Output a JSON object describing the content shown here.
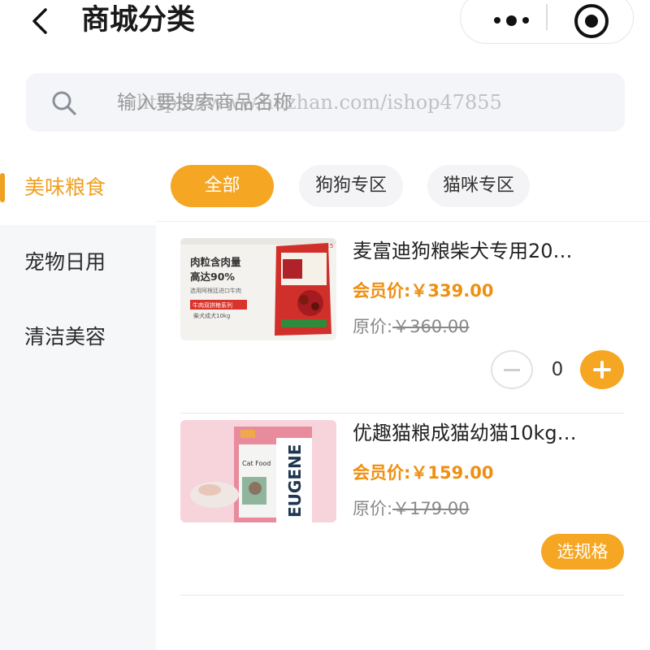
{
  "header": {
    "title": "商城分类",
    "back_icon": "back-arrow-icon",
    "more_icon": "more-dots-icon",
    "close_icon": "target-circle-icon"
  },
  "search": {
    "placeholder": "输入要搜索商品名称",
    "icon": "search-icon"
  },
  "watermark": "https://www.huzhan.com/ishop47855",
  "sidebar": {
    "items": [
      {
        "label": "美味粮食",
        "active": true
      },
      {
        "label": "宠物日用",
        "active": false
      },
      {
        "label": "清洁美容",
        "active": false
      }
    ]
  },
  "tabs": [
    {
      "label": "全部",
      "active": true
    },
    {
      "label": "狗狗专区",
      "active": false
    },
    {
      "label": "猫咪专区",
      "active": false
    }
  ],
  "products": [
    {
      "name": "麦富迪狗粮柴犬专用20…",
      "member_price_label": "会员价:",
      "member_price": "￥339.00",
      "original_price_label": "原价:",
      "original_price": "￥360.00",
      "quantity": "0",
      "image_text": {
        "line1": "肉粒含肉量",
        "line2": "高达90%",
        "line3": "选用阿根廷进口牛肉",
        "tag": "牛肉双拼粮系列",
        "size": "柴犬成犬10kg"
      }
    },
    {
      "name": "优趣猫粮成猫幼猫10kg…",
      "member_price_label": "会员价:",
      "member_price": "￥159.00",
      "original_price_label": "原价:",
      "original_price": "￥179.00",
      "action_label": "选规格",
      "image_text": {
        "brand": "EUGENE",
        "label": "Cat Food"
      }
    }
  ],
  "colors": {
    "accent": "#f5a623",
    "price": "#ef8f10",
    "sidebar_bg": "#f6f7f9",
    "search_bg": "#f4f5f8"
  }
}
